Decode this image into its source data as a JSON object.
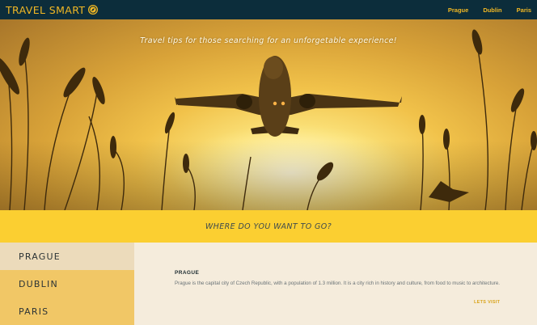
{
  "brand": {
    "name": "TRAVEL SMART",
    "icon": "compass-icon",
    "color": "#f2b824"
  },
  "nav": {
    "links": [
      "Prague",
      "Dublin",
      "Paris"
    ]
  },
  "hero": {
    "tagline": "Travel tips for those searching for an unforgetable experience!"
  },
  "banner": {
    "text": "WHERE DO YOU WANT TO GO?"
  },
  "cities": [
    "PRAGUE",
    "DUBLIN",
    "PARIS"
  ],
  "selected_city": "PRAGUE",
  "detail": {
    "title": "PRAGUE",
    "body": "Prague is the capital city of Czech Republic, with a population of 1.3 million. It is a city rich in history and culture, from food to music to architecture.",
    "link": "LETS VISIT"
  },
  "colors": {
    "navbar": "#0c2d3b",
    "accent": "#f2b824",
    "banner": "#fbcf31",
    "city_bg": "#f1c766",
    "city_active": "#ecdbbb",
    "content_bg": "#f5ecdc"
  }
}
